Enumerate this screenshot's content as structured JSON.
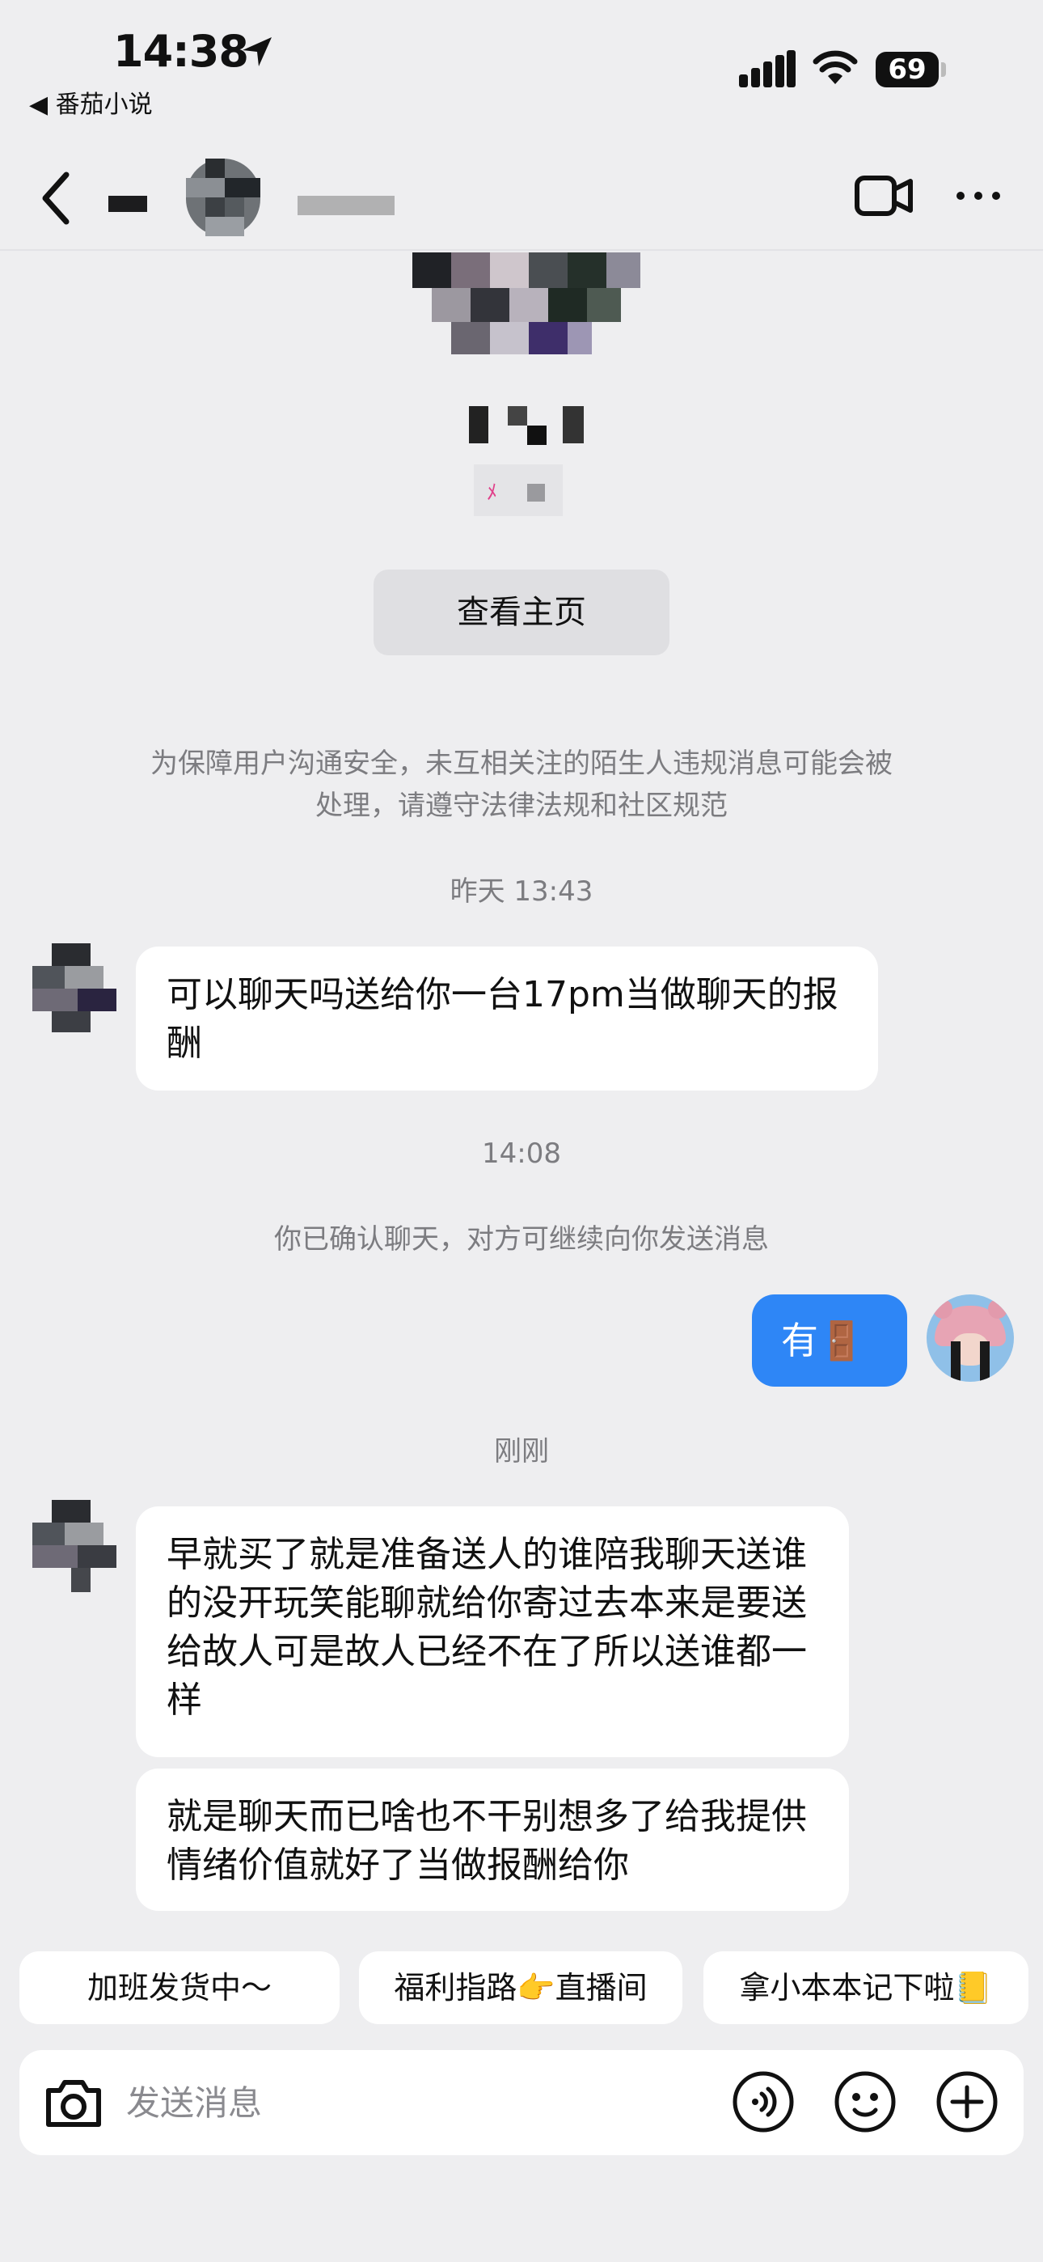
{
  "status_bar": {
    "time": "14:38",
    "back_app": "◀ 番茄小说",
    "battery": "69"
  },
  "header": {
    "contact_name": "",
    "video_call_icon": "video-camera-icon",
    "more_icon": "ellipsis-icon"
  },
  "profile_card": {
    "view_profile_label": "查看主页"
  },
  "notices": {
    "safety_line1": "为保障用户沟通安全，未互相关注的陌生人违规消息可能会被",
    "safety_line2": "处理，请遵守法律法规和社区规范",
    "confirmed": "你已确认聊天，对方可继续向你发送消息"
  },
  "timestamps": {
    "t1": "昨天 13:43",
    "t2": "14:08",
    "t3": "刚刚"
  },
  "messages": {
    "m1": "可以聊天吗送给你一台17pm当做聊天的报酬",
    "m2": "有🚪",
    "m3": "早就买了就是准备送人的谁陪我聊天送谁的没开玩笑能聊就给你寄过去本来是要送给故人可是故人已经不在了所以送谁都一样",
    "m4": "就是聊天而已啥也不干别想多了给我提供情绪价值就好了当做报酬给你"
  },
  "quick_replies": [
    "加班发货中～",
    "福利指路👉直播间",
    "拿小本本记下啦📒"
  ],
  "input": {
    "placeholder": "发送消息"
  },
  "colors": {
    "accent": "#2e86f6",
    "background": "#eeeef0",
    "bubble": "#ffffff"
  }
}
